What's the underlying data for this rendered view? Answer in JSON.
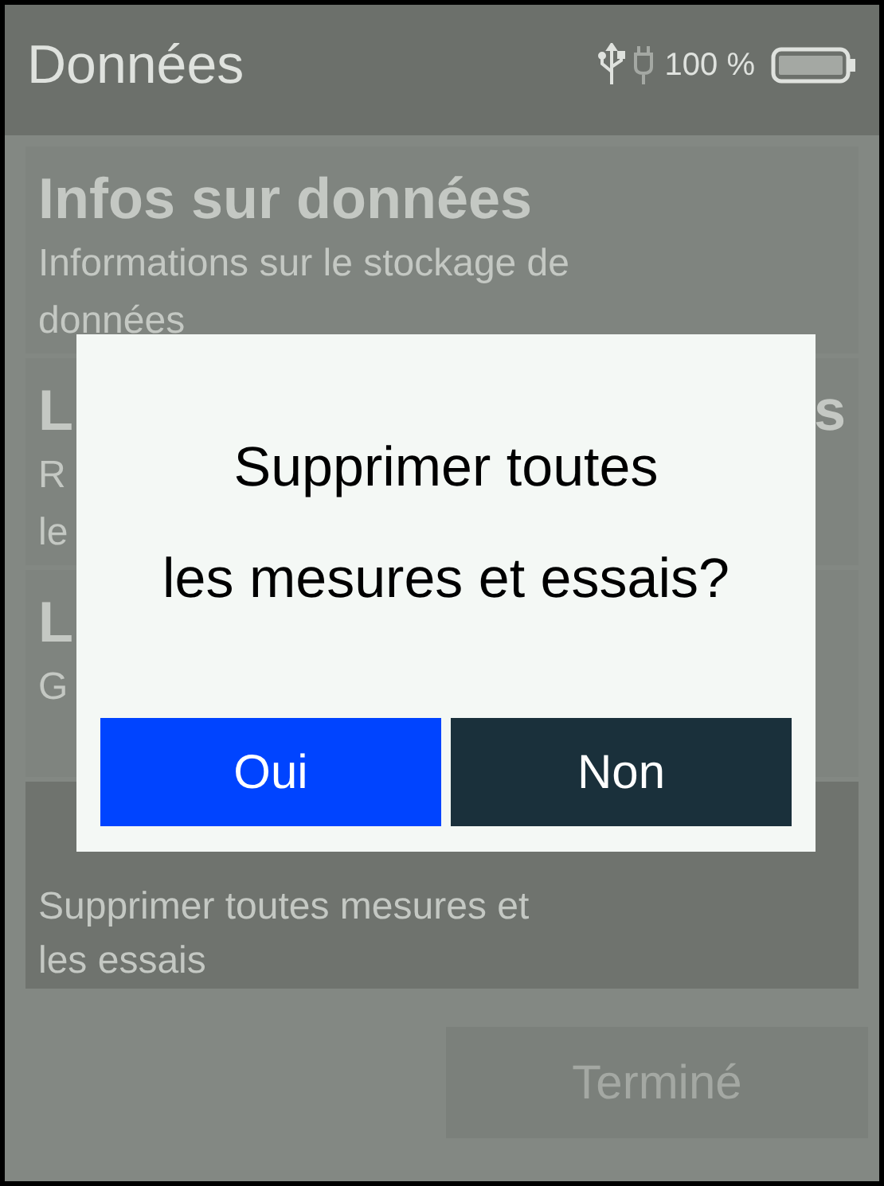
{
  "header": {
    "title": "Données",
    "battery_text": "100 %"
  },
  "items": [
    {
      "title_parts": [
        "Infos sur données"
      ],
      "subtitle_lines": [
        [
          "Informations sur le stockage de"
        ],
        [
          "données"
        ]
      ],
      "selected": false
    },
    {
      "title_parts": [
        "L",
        "s"
      ],
      "subtitle_lines": [
        [
          "R"
        ],
        [
          "le"
        ]
      ],
      "selected": false
    },
    {
      "title_parts": [
        "L"
      ],
      "subtitle_lines": [
        [
          "G"
        ]
      ],
      "selected": false
    },
    {
      "subtitle_lines": [
        [
          "Supprimer toutes mesures et"
        ],
        [
          "les essais"
        ]
      ],
      "selected": true
    }
  ],
  "dialog": {
    "message_lines": [
      "Supprimer toutes",
      "les mesures et essais?"
    ],
    "buttons": [
      {
        "label": "Oui",
        "kind": "primary"
      },
      {
        "label": "Non",
        "kind": "secondary"
      }
    ]
  },
  "done_button": {
    "label": "Terminé",
    "disabled": true
  }
}
